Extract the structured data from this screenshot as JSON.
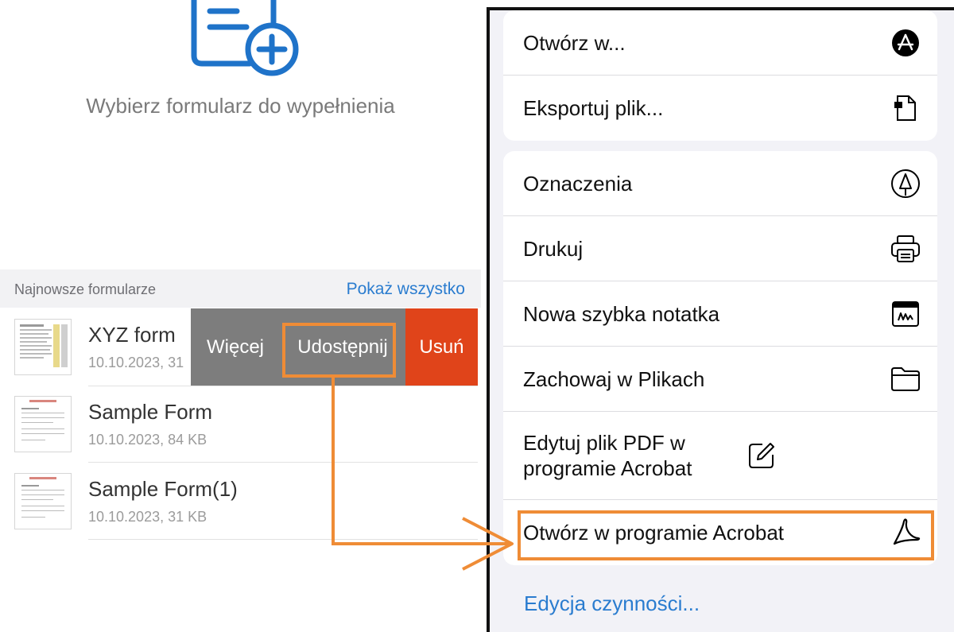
{
  "left": {
    "subtitle": "Wybierz formularz do wypełnienia",
    "recent": {
      "title": "Najnowsze formularze",
      "show_all": "Pokaż wszystko"
    },
    "forms": [
      {
        "title": "XYZ form",
        "meta": "10.10.2023, 31"
      },
      {
        "title": "Sample Form",
        "meta": "10.10.2023, 84 KB"
      },
      {
        "title": "Sample Form(1)",
        "meta": "10.10.2023, 31 KB"
      }
    ],
    "swipe_actions": {
      "more": "Więcej",
      "share": "Udostępnij",
      "delete": "Usuń"
    }
  },
  "share_sheet": {
    "group1": [
      {
        "label": "Otwórz w...",
        "icon": "app-store-icon"
      },
      {
        "label": "Eksportuj plik...",
        "icon": "export-file-icon"
      }
    ],
    "group2": [
      {
        "label": "Oznaczenia",
        "icon": "markup-pen-icon"
      },
      {
        "label": "Drukuj",
        "icon": "printer-icon"
      },
      {
        "label": "Nowa szybka notatka",
        "icon": "quick-note-icon"
      },
      {
        "label": "Zachowaj w Plikach",
        "icon": "folder-icon"
      },
      {
        "label": "Edytuj plik PDF w programie Acrobat",
        "icon": "edit-pencil-icon"
      },
      {
        "label": "Otwórz w programie Acrobat",
        "icon": "acrobat-icon"
      }
    ],
    "edit_actions": "Edycja czynności..."
  },
  "colors": {
    "accent_blue": "#2a7ccf",
    "highlight_orange": "#ef8c36",
    "delete_red": "#e0441a",
    "swipe_gray": "#7d7d7d"
  }
}
